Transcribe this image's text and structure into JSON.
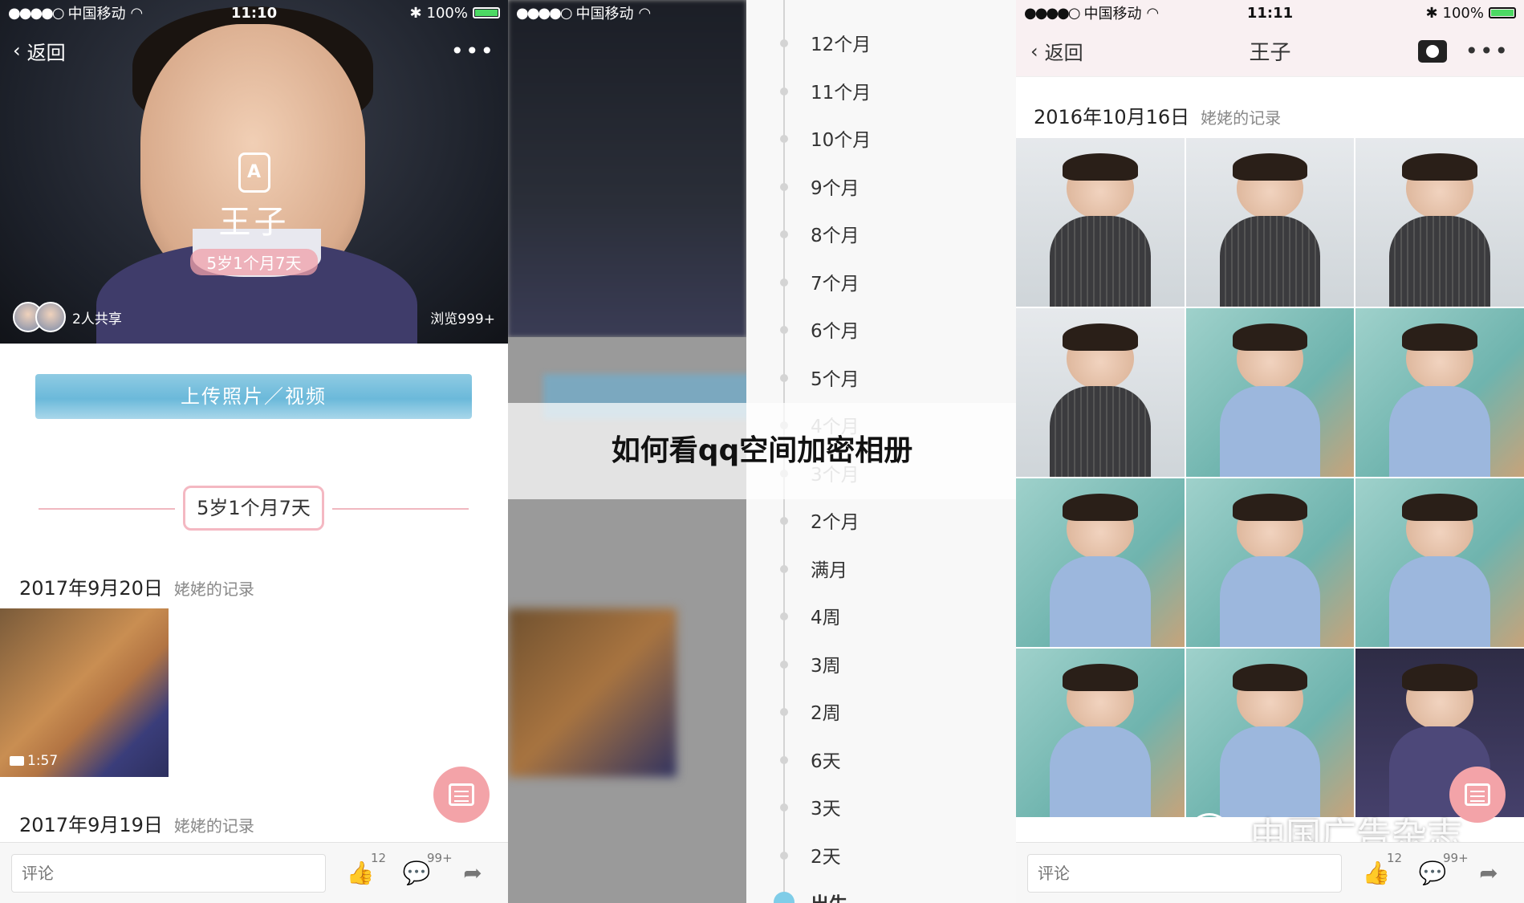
{
  "status": {
    "carrier": "中国移动",
    "battery": "100%",
    "time_left": "11:10",
    "time_right": "11:11"
  },
  "nav": {
    "back_label": "返回",
    "more_label": "•••"
  },
  "profile": {
    "jar_letter": "A",
    "name": "王子",
    "age": "5岁1个月7天",
    "shared": "2人共享",
    "views": "浏览999+"
  },
  "upload_label": "上传照片／视频",
  "section_age": "5岁1个月7天",
  "records": [
    {
      "date": "2017年9月20日",
      "author": "姥姥的记录"
    },
    {
      "date": "2017年9月19日",
      "author": "姥姥的记录"
    }
  ],
  "video": {
    "duration": "1:57"
  },
  "comment": {
    "placeholder": "评论",
    "likes": "12",
    "comments": "99+"
  },
  "timeline": {
    "items": [
      "12个月",
      "11个月",
      "10个月",
      "9个月",
      "8个月",
      "7个月",
      "6个月",
      "5个月",
      "4个月",
      "3个月",
      "2个月",
      "满月",
      "4周",
      "3周",
      "2周",
      "6天",
      "3天",
      "2天",
      "出生"
    ]
  },
  "caption": "如何看qq空间加密相册",
  "album": {
    "title": "王子",
    "date": "2016年10月16日",
    "author": "姥姥的记录"
  },
  "watermark": "中国广告杂志",
  "colors": {
    "accent_pink": "#f3a3a8",
    "upload_blue": "#6bb9da",
    "battery_green": "#4cd964"
  }
}
